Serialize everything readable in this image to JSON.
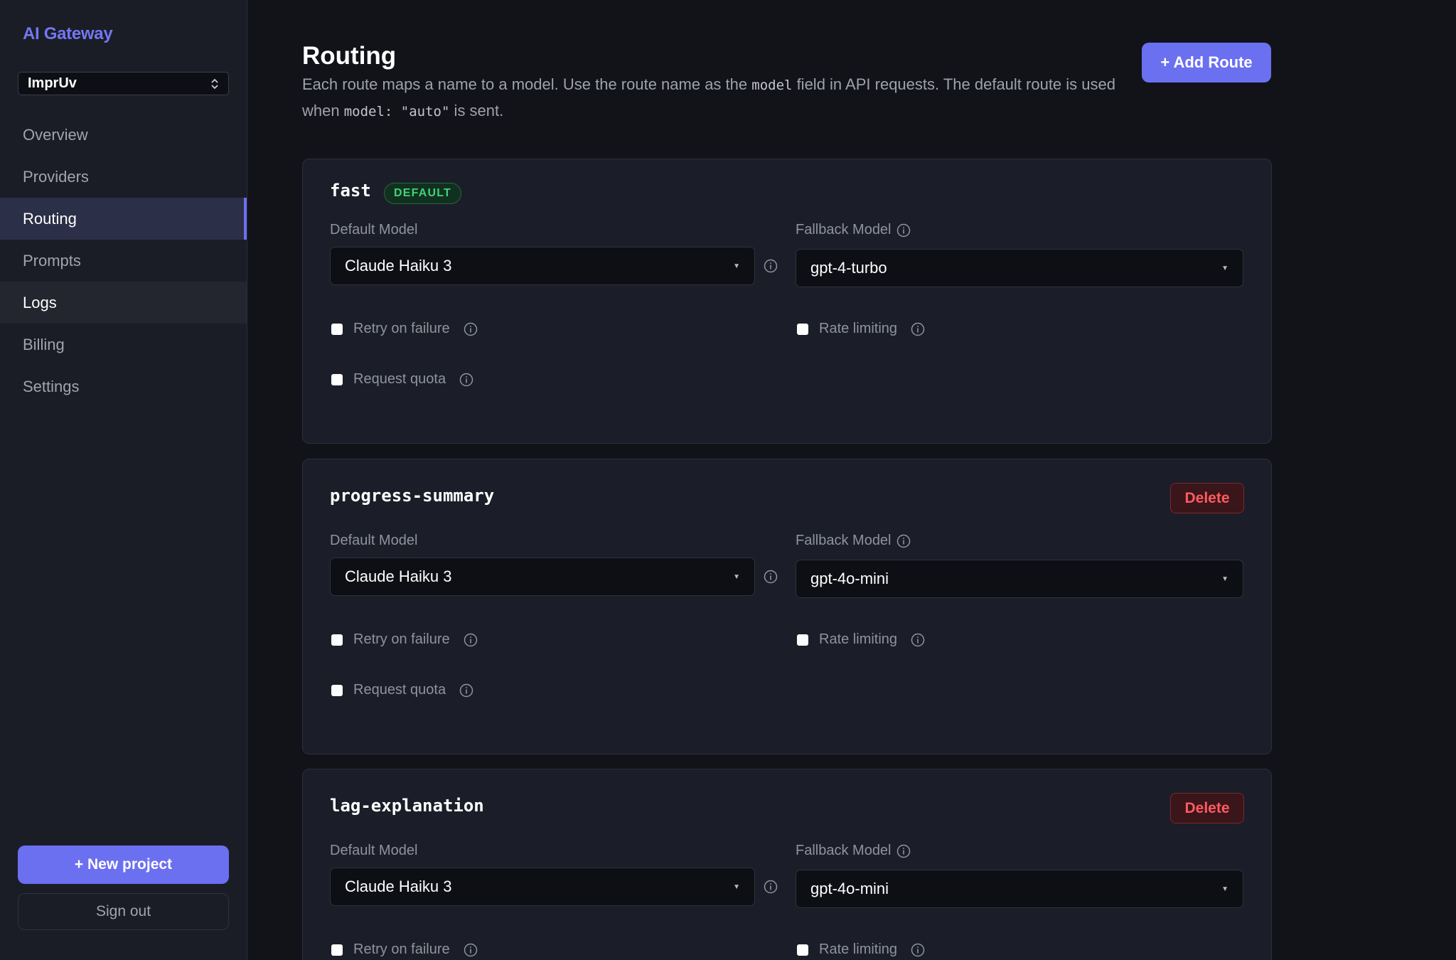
{
  "app": {
    "brand": "AI Gateway"
  },
  "sidebar": {
    "project": "ImprUv",
    "nav": [
      {
        "label": "Overview"
      },
      {
        "label": "Providers"
      },
      {
        "label": "Routing"
      },
      {
        "label": "Prompts"
      },
      {
        "label": "Logs"
      },
      {
        "label": "Billing"
      },
      {
        "label": "Settings"
      }
    ],
    "active": "Routing",
    "new_project_label": "+ New project",
    "sign_out_label": "Sign out"
  },
  "header": {
    "title": "Routing",
    "desc_part1": "Each route maps a name to a model. Use the route name as the ",
    "desc_code1": "model",
    "desc_part2": " field in API requests. The default route is used when ",
    "desc_code2": "model: \"auto\"",
    "desc_part3": " is sent.",
    "add_route_label": "+ Add Route"
  },
  "labels": {
    "default_model": "Default Model",
    "fallback_model": "Fallback Model",
    "retry": "Retry on failure",
    "rate_limiting": "Rate limiting",
    "request_quota": "Request quota",
    "delete": "Delete",
    "default_badge": "DEFAULT"
  },
  "routes": [
    {
      "name": "fast",
      "is_default": true,
      "default_model": "Claude Haiku 3",
      "fallback_model": "gpt-4-turbo",
      "retry": false,
      "rate_limiting": false,
      "request_quota": false
    },
    {
      "name": "progress-summary",
      "is_default": false,
      "default_model": "Claude Haiku 3",
      "fallback_model": "gpt-4o-mini",
      "retry": false,
      "rate_limiting": false,
      "request_quota": false
    },
    {
      "name": "lag-explanation",
      "is_default": false,
      "default_model": "Claude Haiku 3",
      "fallback_model": "gpt-4o-mini",
      "retry": false,
      "rate_limiting": false
    }
  ],
  "icons": {
    "info": "info-circle-icon",
    "caret": "caret-down-icon",
    "updown": "chevron-updown-icon"
  },
  "colors": {
    "accent": "#6b70f0",
    "danger": "#ff5a62",
    "success": "#3fd47a"
  }
}
